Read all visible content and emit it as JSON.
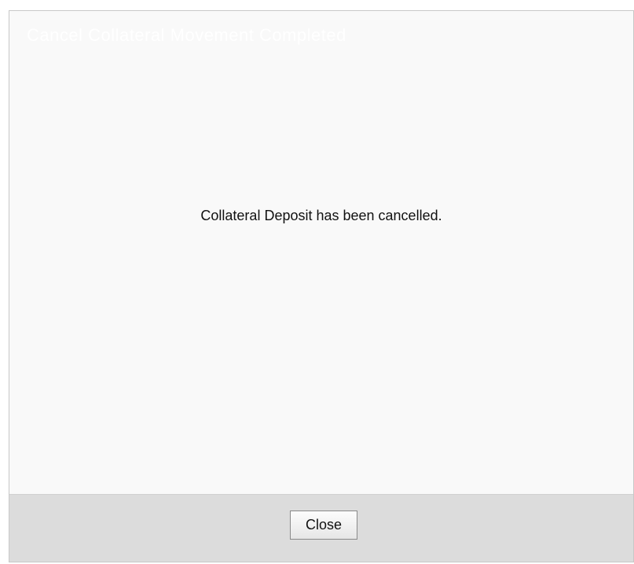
{
  "dialog": {
    "title": "Cancel Collateral Movement Completed",
    "message": "Collateral Deposit has been cancelled.",
    "close_label": "Close"
  }
}
